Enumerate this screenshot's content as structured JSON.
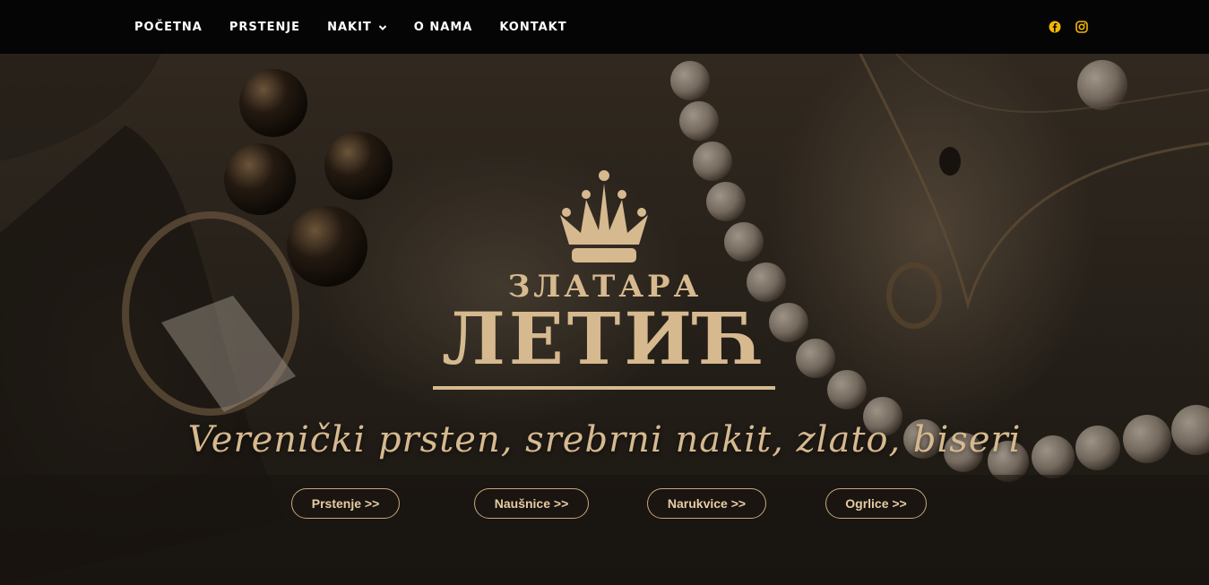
{
  "nav": {
    "items": [
      {
        "label": "POČETNA"
      },
      {
        "label": "PRSTENJE"
      },
      {
        "label": "NAKIT",
        "has_dropdown": true
      },
      {
        "label": "O NAMA"
      },
      {
        "label": "KONTAKT"
      }
    ],
    "social_icons": [
      "facebook-icon",
      "instagram-icon"
    ]
  },
  "hero": {
    "logo_line1": "ЗЛАТАРА",
    "logo_line2": "ЛЕТИЋ",
    "tagline": "Verenički prsten, srebrni nakit, zlato, biseri",
    "buttons": [
      {
        "label": "Prstenje >>"
      },
      {
        "label": "Naušnice >>"
      },
      {
        "label": "Narukvice >>"
      },
      {
        "label": "Ogrlice >>"
      }
    ]
  },
  "colors": {
    "nav_bg": "#050505",
    "accent_gold": "#d6b98f",
    "social_icon": "#f2b705"
  }
}
